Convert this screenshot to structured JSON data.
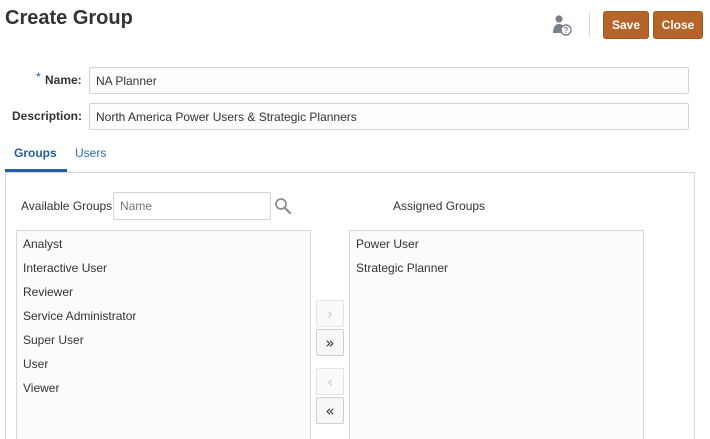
{
  "header": {
    "title": "Create Group",
    "save_label": "Save",
    "close_label": "Close",
    "help_icon": "user-help-icon",
    "accent_color": "#b5652a"
  },
  "form": {
    "required_marker": "*",
    "name_label": "Name:",
    "name_value": "NA Planner",
    "description_label": "Description:",
    "description_value": "North America Power Users & Strategic Planners"
  },
  "tabs": [
    {
      "label": "Groups",
      "selected": true
    },
    {
      "label": "Users",
      "selected": false
    }
  ],
  "groups_panel": {
    "available_label": "Available Groups",
    "search_placeholder": "Name",
    "search_icon": "magnifier-icon",
    "assigned_label": "Assigned Groups",
    "available_items": [
      "Analyst",
      "Interactive User",
      "Reviewer",
      "Service Administrator",
      "Super User",
      "User",
      "Viewer"
    ],
    "assigned_items": [
      "Power User",
      "Strategic Planner"
    ],
    "shuttle": {
      "move_selected": "›",
      "move_all": "»",
      "remove_selected": "‹",
      "remove_all": "«"
    }
  }
}
